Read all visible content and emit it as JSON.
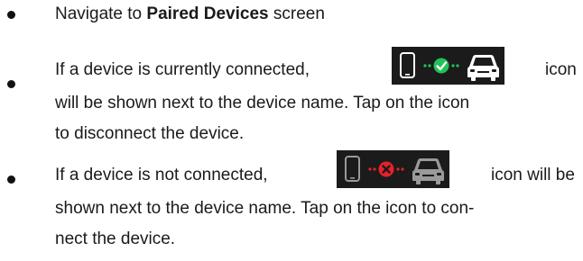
{
  "items": [
    {
      "before": "Navigate to ",
      "bold": "Paired Devices",
      "after": " screen"
    },
    {
      "line1_before": "If a device is currently connected,",
      "line1_after": "icon",
      "line2": "will be shown next to the device name. Tap on the icon",
      "line3": "to disconnect the device.",
      "icon": "phone-connected-car-icon"
    },
    {
      "line1_before": "If a device is not connected,",
      "line1_after": "icon will be",
      "line2": "shown next to the device name. Tap on the icon to con-",
      "line3": "nect the device.",
      "icon": "phone-disconnected-car-icon"
    }
  ],
  "colors": {
    "connected": "#21c25a",
    "disconnected": "#e8202a",
    "icon_bg": "#1b1b1b"
  }
}
